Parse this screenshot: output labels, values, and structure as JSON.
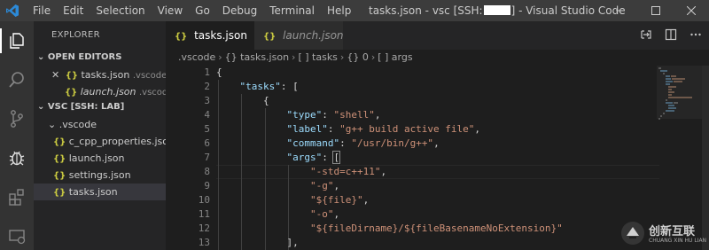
{
  "titlebar": {
    "menu": [
      "File",
      "Edit",
      "Selection",
      "View",
      "Go",
      "Debug",
      "Terminal",
      "Help"
    ],
    "title_prefix": "tasks.json - vsc [SSH:",
    "title_suffix": "] - Visual Studio Code"
  },
  "sidebar": {
    "title": "EXPLORER",
    "open_editors_header": "OPEN EDITORS",
    "open_editors": [
      {
        "icon": "{}",
        "name": "tasks.json",
        "folder": ".vscode"
      },
      {
        "icon": "{}",
        "name": "launch.json",
        "folder": ".vscode"
      }
    ],
    "workspace_header": "VSC [SSH: LAB]",
    "folder": ".vscode",
    "files": [
      {
        "icon": "{}",
        "name": "c_cpp_properties.json"
      },
      {
        "icon": "{}",
        "name": "launch.json"
      },
      {
        "icon": "{}",
        "name": "settings.json"
      },
      {
        "icon": "{}",
        "name": "tasks.json"
      }
    ]
  },
  "tabs": [
    {
      "icon": "{}",
      "label": "tasks.json",
      "close": "×"
    },
    {
      "icon": "{}",
      "label": "launch.json"
    }
  ],
  "breadcrumb": [
    ".vscode",
    "{} tasks.json",
    "[ ] tasks",
    "{} 0",
    "[ ] args"
  ],
  "editor": {
    "line_numbers": [
      "1",
      "2",
      "3",
      "4",
      "5",
      "6",
      "7",
      "8",
      "9",
      "10",
      "11",
      "12",
      "13"
    ],
    "lines": {
      "l1": "{",
      "l2k": "\"tasks\"",
      "l2p": ": [",
      "l3": "{",
      "l4k": "\"type\"",
      "l4s": "\"shell\"",
      "l5k": "\"label\"",
      "l5s": "\"g++ build active file\"",
      "l6k": "\"command\"",
      "l6s": "\"/usr/bin/g++\"",
      "l7k": "\"args\"",
      "l7p": "[",
      "l8": "\"-std=c++11\"",
      "l9": "\"-g\"",
      "l10": "\"${file}\"",
      "l11": "\"-o\"",
      "l12": "\"${fileDirname}/${fileBasenameNoExtension}\"",
      "l13": "],"
    }
  },
  "watermark": {
    "title": "创新互联",
    "subtitle": "CHUANG XIN HU LIAN"
  },
  "colors": {
    "accent": "#007acc",
    "json_icon": "#cbcb41"
  }
}
